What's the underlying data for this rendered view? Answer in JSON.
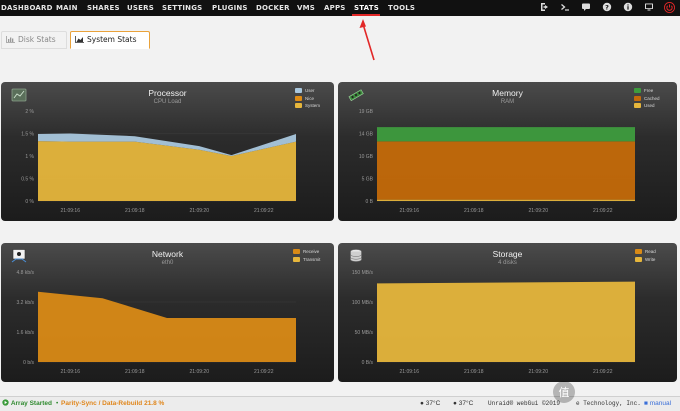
{
  "nav": {
    "items": [
      "DASHBOARD",
      "MAIN",
      "SHARES",
      "USERS",
      "SETTINGS",
      "PLUGINS",
      "DOCKER",
      "VMS",
      "APPS",
      "STATS",
      "TOOLS"
    ],
    "active": "STATS",
    "accent_color": "#e22828",
    "right_icons": [
      "logout-icon",
      "terminal-icon",
      "feedback-icon",
      "help-icon",
      "info-icon",
      "monitor-icon",
      "power-icon"
    ]
  },
  "tabs": [
    {
      "label": "Disk Stats",
      "active": false
    },
    {
      "label": "System Stats",
      "active": true
    }
  ],
  "panels": {
    "processor": {
      "title": "Processor",
      "subtitle": "CPU Load",
      "legend": [
        {
          "label": "User",
          "color": "#a9c7dd"
        },
        {
          "label": "Nice",
          "color": "#e08c13"
        },
        {
          "label": "System",
          "color": "#e6b63c"
        }
      ],
      "yticks": [
        "2 %",
        "1.5 %",
        "1 %",
        "0.5 %",
        "0 %"
      ],
      "xticks": [
        "21:09:16",
        "21:09:18",
        "21:09:20",
        "21:09:22"
      ]
    },
    "memory": {
      "title": "Memory",
      "subtitle": "RAM",
      "legend": [
        {
          "label": "Free",
          "color": "#3e9c3e"
        },
        {
          "label": "Cached",
          "color": "#c46a0a"
        },
        {
          "label": "Used",
          "color": "#e6b63c"
        }
      ],
      "yticks": [
        "19 GB",
        "14 GB",
        "10 GB",
        "5 GB",
        "0 B"
      ],
      "xticks": [
        "21:09:16",
        "21:09:18",
        "21:09:20",
        "21:09:22"
      ]
    },
    "network": {
      "title": "Network",
      "subtitle": "eth0",
      "legend": [
        {
          "label": "Receive",
          "color": "#d98a16"
        },
        {
          "label": "Transmit",
          "color": "#e6b63c"
        }
      ],
      "yticks": [
        "4.8 kb/s",
        "3.2 kb/s",
        "1.6 kb/s",
        "0 b/s"
      ],
      "xticks": [
        "21:09:16",
        "21:09:18",
        "21:09:20",
        "21:09:22"
      ]
    },
    "storage": {
      "title": "Storage",
      "subtitle": "4 disks",
      "legend": [
        {
          "label": "Read",
          "color": "#d98a16"
        },
        {
          "label": "Write",
          "color": "#e6b63c"
        }
      ],
      "yticks": [
        "150 MB/s",
        "100 MB/s",
        "50 MB/s",
        "0 B/s"
      ],
      "xticks": [
        "21:09:16",
        "21:09:18",
        "21:09:20",
        "21:09:22"
      ]
    }
  },
  "chart_data": [
    {
      "type": "area",
      "title": "Processor",
      "subtitle": "CPU Load",
      "ylim": [
        0,
        2
      ],
      "x": [
        "21:09:15",
        "21:09:16",
        "21:09:18",
        "21:09:20",
        "21:09:21",
        "21:09:23"
      ],
      "series": [
        {
          "name": "System",
          "values": [
            1.33,
            1.32,
            1.32,
            1.14,
            1.0,
            1.32
          ]
        },
        {
          "name": "Nice",
          "values": [
            0,
            0,
            0,
            0,
            0,
            0
          ]
        },
        {
          "name": "User",
          "values": [
            0.16,
            0.18,
            0.12,
            0.08,
            0.02,
            0.17
          ]
        }
      ]
    },
    {
      "type": "area",
      "title": "Memory",
      "subtitle": "RAM",
      "ylim": [
        0,
        19
      ],
      "x": [
        "21:09:15",
        "21:09:23"
      ],
      "series": [
        {
          "name": "Used",
          "values": [
            0.3,
            0.3
          ]
        },
        {
          "name": "Cached",
          "values": [
            12.3,
            12.3
          ]
        },
        {
          "name": "Free",
          "values": [
            3.0,
            3.0
          ]
        }
      ]
    },
    {
      "type": "area",
      "title": "Network",
      "subtitle": "eth0",
      "ylim": [
        0,
        4.8
      ],
      "x": [
        "21:09:15",
        "21:09:17",
        "21:09:19",
        "21:09:21",
        "21:09:23"
      ],
      "series": [
        {
          "name": "Transmit",
          "values": [
            0,
            0,
            0,
            0,
            0
          ]
        },
        {
          "name": "Receive",
          "values": [
            3.75,
            3.4,
            2.35,
            2.35,
            2.35
          ]
        }
      ]
    },
    {
      "type": "area",
      "title": "Storage",
      "subtitle": "4 disks",
      "ylim": [
        0,
        150
      ],
      "x": [
        "21:09:15",
        "21:09:23"
      ],
      "series": [
        {
          "name": "Read",
          "values": [
            0,
            0
          ]
        },
        {
          "name": "Write",
          "values": [
            131,
            134
          ]
        }
      ]
    }
  ],
  "statusbar": {
    "array_status": "Array Started",
    "parity": "Parity-Sync / Data-Rebuild 21.8 %",
    "temp1": "37°C",
    "temp2": "37°C",
    "footer": "Unraid® webGui ©2019",
    "footer_end": "e Technology, Inc.",
    "manual": "manual"
  }
}
